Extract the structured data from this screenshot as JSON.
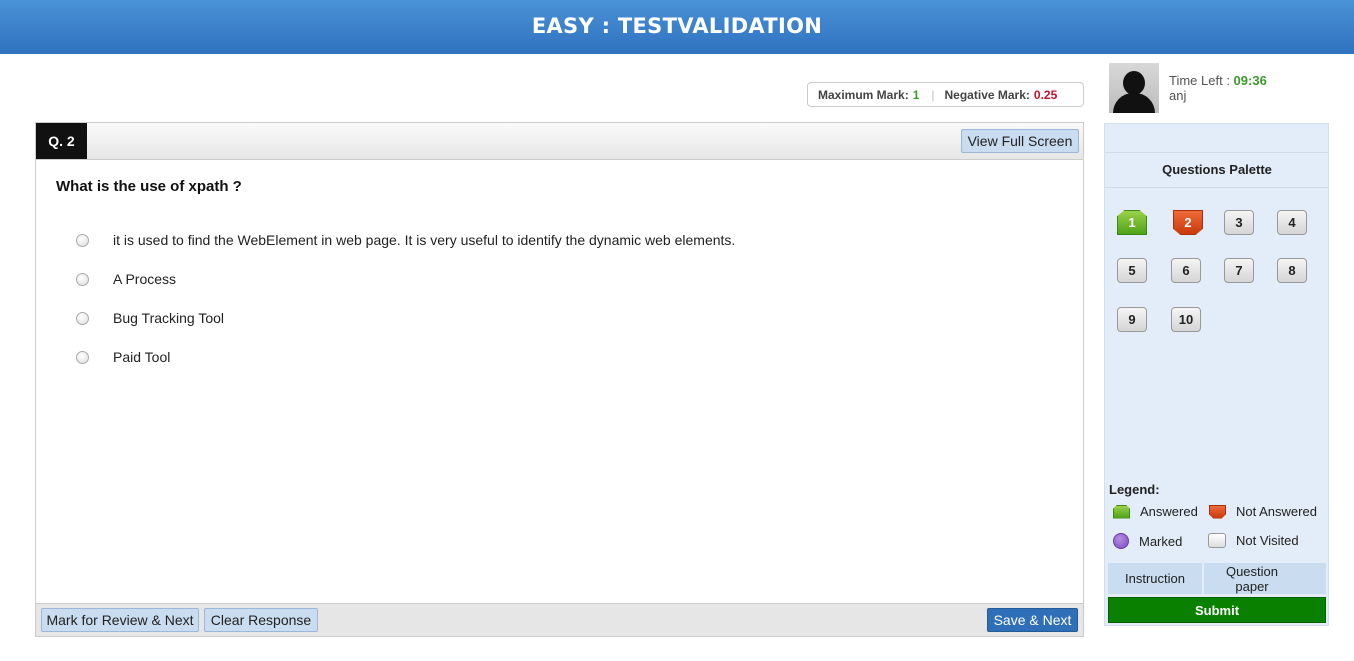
{
  "header": {
    "title": "EASY : TESTVALIDATION"
  },
  "marks": {
    "max_label": "Maximum Mark:",
    "max_value": "1",
    "neg_label": "Negative Mark:",
    "neg_value": "0.25"
  },
  "question": {
    "number": "Q. 2",
    "fullscreen_label": "View Full Screen",
    "text": "What is the use of xpath ?",
    "options": [
      "it is used to find the WebElement in web page. It is very useful to identify the dynamic web elements.",
      "A Process",
      "Bug Tracking Tool",
      "Paid Tool"
    ]
  },
  "footer": {
    "review_label": "Mark for Review & Next",
    "clear_label": "Clear Response",
    "save_label": "Save & Next"
  },
  "candidate": {
    "time_label": "Time Left : ",
    "time_value": "09:36",
    "name": "anj"
  },
  "palette": {
    "title": "Questions Palette",
    "questions": [
      {
        "label": "1",
        "status": "answered"
      },
      {
        "label": "2",
        "status": "not-answered"
      },
      {
        "label": "3",
        "status": "not-visited"
      },
      {
        "label": "4",
        "status": "not-visited"
      },
      {
        "label": "5",
        "status": "not-visited"
      },
      {
        "label": "6",
        "status": "not-visited"
      },
      {
        "label": "7",
        "status": "not-visited"
      },
      {
        "label": "8",
        "status": "not-visited"
      },
      {
        "label": "9",
        "status": "not-visited"
      },
      {
        "label": "10",
        "status": "not-visited"
      }
    ],
    "legend_title": "Legend:",
    "legend": {
      "answered": "Answered",
      "not_answered": "Not Answered",
      "marked": "Marked",
      "not_visited": "Not Visited"
    },
    "instruction_label": "Instruction",
    "question_paper_label": "Question paper",
    "submit_label": "Submit"
  },
  "colors": {
    "header": "#3a82cc",
    "answered": "#5aae1f",
    "not_answered": "#d84a1a",
    "marked": "#8a5ccc",
    "submit": "#0a8000",
    "save": "#2f6fb7"
  }
}
